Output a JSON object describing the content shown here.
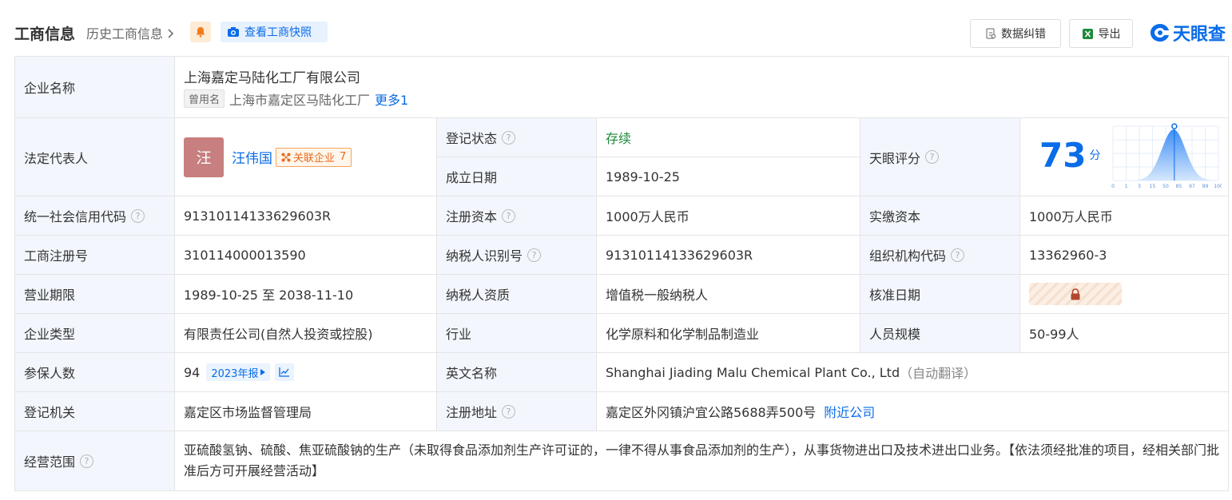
{
  "header": {
    "title": "工商信息",
    "history": "历史工商信息",
    "snapshot_btn": "查看工商快照",
    "correct_btn": "数据纠错",
    "export_btn": "导出",
    "logo_text": "天眼查"
  },
  "company": {
    "name_label": "企业名称",
    "name": "上海嘉定马陆化工厂有限公司",
    "used_name_tag": "曾用名",
    "used_name": "上海市嘉定区马陆化工厂",
    "more": "更多1"
  },
  "legal": {
    "label": "法定代表人",
    "avatar": "汪",
    "name": "汪伟国",
    "related": "关联企业",
    "related_count": "7"
  },
  "reg_status": {
    "label": "登记状态",
    "value": "存续"
  },
  "founded": {
    "label": "成立日期",
    "value": "1989-10-25"
  },
  "score": {
    "label": "天眼评分",
    "value": "73",
    "unit": "分",
    "level": 73,
    "ticks": [
      "0",
      "1",
      "3",
      "15",
      "50",
      "85",
      "97",
      "99",
      "100"
    ]
  },
  "rows": {
    "credit_label": "统一社会信用代码",
    "credit": "91310114133629603R",
    "reg_capital_label": "注册资本",
    "reg_capital": "1000万人民币",
    "paid_capital_label": "实缴资本",
    "paid_capital": "1000万人民币",
    "reg_no_label": "工商注册号",
    "reg_no": "310114000013590",
    "taxpayer_id_label": "纳税人识别号",
    "taxpayer_id": "91310114133629603R",
    "org_code_label": "组织机构代码",
    "org_code": "13362960-3",
    "term_label": "营业期限",
    "term": "1989-10-25 至 2038-11-10",
    "tax_quality_label": "纳税人资质",
    "tax_quality": "增值税一般纳税人",
    "approve_label": "核准日期",
    "type_label": "企业类型",
    "type": "有限责任公司(自然人投资或控股)",
    "industry_label": "行业",
    "industry": "化学原料和化学制品制造业",
    "staff_label": "人员规模",
    "staff": "50-99人",
    "insured_label": "参保人数",
    "insured": "94",
    "insured_report": "2023年报",
    "en_name_label": "英文名称",
    "en_name": "Shanghai Jiading Malu Chemical Plant Co., Ltd",
    "en_name_note": "（自动翻译）",
    "authority_label": "登记机关",
    "authority": "嘉定区市场监督管理局",
    "address_label": "注册地址",
    "address": "嘉定区外冈镇沪宜公路5688弄500号",
    "nearby": "附近公司",
    "scope_label": "经营范围",
    "scope": "亚硫酸氢钠、硫酸、焦亚硫酸钠的生产（未取得食品添加剂生产许可证的，一律不得从事食品添加剂的生产），从事货物进出口及技术进出口业务。【依法须经批准的项目，经相关部门批准后方可开展经营活动】"
  },
  "colors": {
    "accent": "#0a6ce8",
    "label_bg": "#f3f7fd",
    "status_green": "#1e8a3b"
  },
  "icons": [
    "chevron-right-icon",
    "bell-icon",
    "camera-icon",
    "edit-doc-icon",
    "excel-icon",
    "help-icon",
    "network-icon",
    "line-chart-icon",
    "lock-icon",
    "play-icon"
  ]
}
